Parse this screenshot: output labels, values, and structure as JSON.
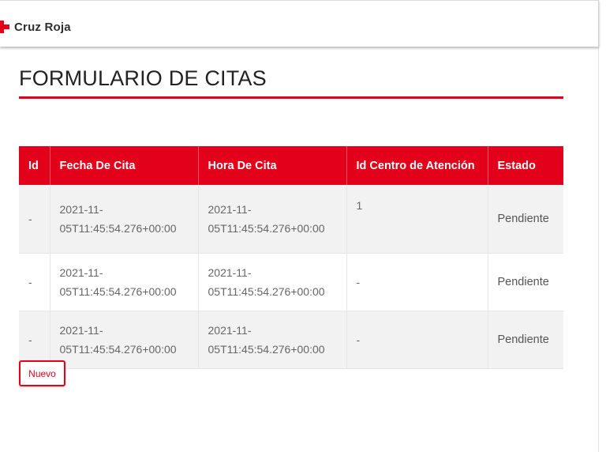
{
  "header": {
    "brand": "Cruz Roja"
  },
  "page": {
    "title": "FORMULARIO DE CITAS"
  },
  "table": {
    "columns": [
      "Id",
      "Fecha De Cita",
      "Hora De Cita",
      "Id Centro de Atención",
      "Estado"
    ],
    "rows": [
      {
        "id": "-",
        "fecha": "2021-11-05T11:45:54.276+00:00",
        "hora": "2021-11-05T11:45:54.276+00:00",
        "centro": "1",
        "estado": "Pendiente"
      },
      {
        "id": "-",
        "fecha": "2021-11-05T11:45:54.276+00:00",
        "hora": "2021-11-05T11:45:54.276+00:00",
        "centro": "-",
        "estado": "Pendiente"
      },
      {
        "id": "-",
        "fecha": "2021-11-05T11:45:54.276+00:00",
        "hora": "2021-11-05T11:45:54.276+00:00",
        "centro": "-",
        "estado": "Pendiente"
      }
    ]
  },
  "actions": {
    "new_label": "Nuevo"
  },
  "colors": {
    "accent": "#e2001a"
  }
}
